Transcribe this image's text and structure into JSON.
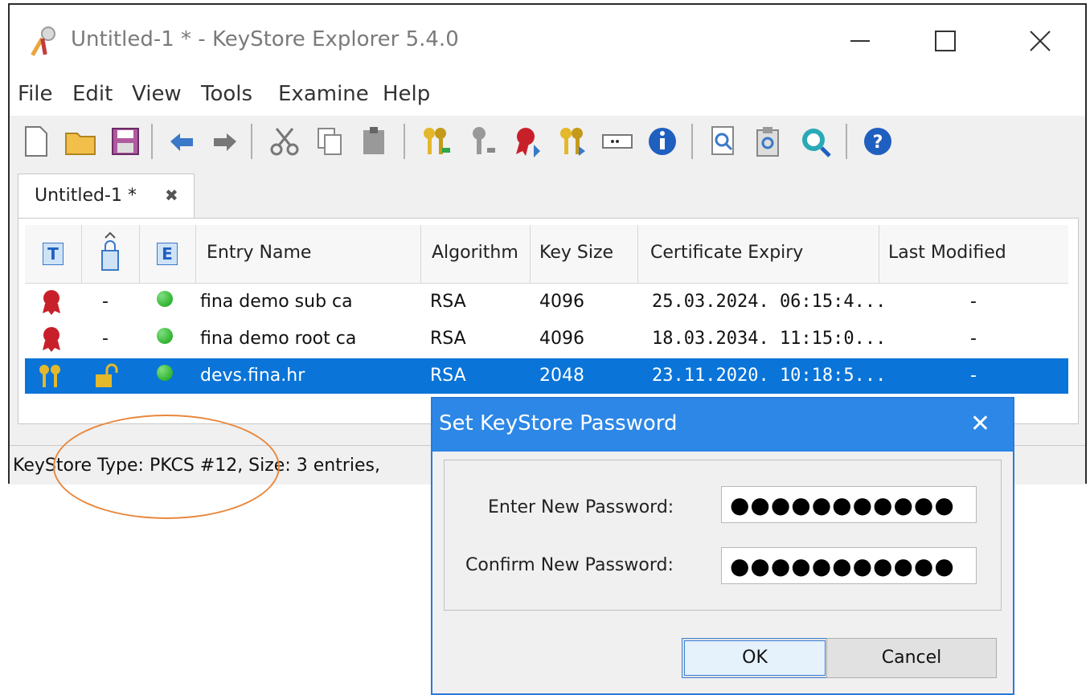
{
  "window": {
    "title": "Untitled-1 * - KeyStore Explorer 5.4.0"
  },
  "menu": [
    "File",
    "Edit",
    "View",
    "Tools",
    "Examine",
    "Help"
  ],
  "toolbar": [
    "new-document-icon",
    "open-folder-icon",
    "save-icon",
    "undo-icon",
    "redo-icon",
    "cut-icon",
    "copy-icon",
    "paste-icon",
    "generate-key-pair-icon",
    "generate-secret-key-icon",
    "import-trusted-cert-icon",
    "import-key-pair-icon",
    "set-password-icon",
    "properties-icon",
    "examine-file-icon",
    "examine-clipboard-icon",
    "examine-ssl-icon",
    "help-icon"
  ],
  "tab": {
    "label": "Untitled-1 *",
    "close": "✖"
  },
  "table": {
    "icon_headers": [
      "T",
      "E"
    ],
    "columns": [
      "Entry Name",
      "Algorithm",
      "Key Size",
      "Certificate Expiry",
      "Last Modified"
    ],
    "rows": [
      {
        "type_icon": "trusted-certificate-icon",
        "lock": "-",
        "name": "fina demo sub ca",
        "algorithm": "RSA",
        "key_size": "4096",
        "expiry": "25.03.2024. 06:15:4...",
        "modified": "-"
      },
      {
        "type_icon": "trusted-certificate-icon",
        "lock": "-",
        "name": "fina demo root ca",
        "algorithm": "RSA",
        "key_size": "4096",
        "expiry": "18.03.2034. 11:15:0...",
        "modified": "-"
      },
      {
        "type_icon": "key-pair-icon",
        "lock": "unlocked-icon",
        "name": "devs.fina.hr",
        "algorithm": "RSA",
        "key_size": "2048",
        "expiry": "23.11.2020. 10:18:5...",
        "modified": "-",
        "selected": true
      }
    ]
  },
  "status": {
    "text": "KeyStore Type: PKCS #12, Size: 3 entries,"
  },
  "dialog": {
    "title": "Set KeyStore Password",
    "close": "✕",
    "enter_label": "Enter New Password:",
    "enter_value": "●●●●●●●●●●●",
    "confirm_label": "Confirm New Password:",
    "confirm_value": "●●●●●●●●●●●",
    "ok": "OK",
    "cancel": "Cancel"
  },
  "colors": {
    "selection": "#0a74d8",
    "dialog_title": "#2d87e6",
    "annotation": "#e8883e"
  }
}
